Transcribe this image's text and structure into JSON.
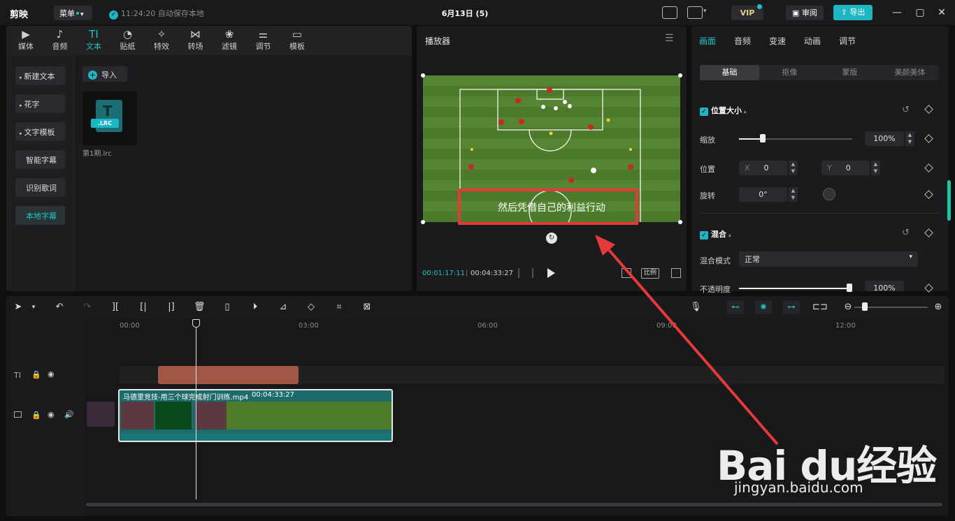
{
  "app": {
    "logo": "剪映",
    "menu": "菜单",
    "autosave": "11:24:20 自动保存本地",
    "title": "6月13日 (5)",
    "vip": "VIP",
    "review": "审阅",
    "export": "导出"
  },
  "left": {
    "tabs": [
      {
        "label": "媒体",
        "icon": "media-icon"
      },
      {
        "label": "音频",
        "icon": "audio-icon"
      },
      {
        "label": "文本",
        "icon": "text-icon",
        "active": true
      },
      {
        "label": "贴纸",
        "icon": "sticker-icon"
      },
      {
        "label": "特效",
        "icon": "effect-icon"
      },
      {
        "label": "转场",
        "icon": "transition-icon"
      },
      {
        "label": "滤镜",
        "icon": "filter-icon"
      },
      {
        "label": "调节",
        "icon": "adjust-icon"
      },
      {
        "label": "模板",
        "icon": "template-icon"
      }
    ],
    "side": [
      "新建文本",
      "花字",
      "文字模板",
      "智能字幕",
      "识别歌词",
      "本地字幕"
    ],
    "import": "导入",
    "file": {
      "name": "第1期.lrc",
      "tag": ".LRC"
    }
  },
  "player": {
    "title": "播放器",
    "subtitle": "然后凭借自己的利益行动",
    "current": "00:01:17:11",
    "duration": "00:04:33:27",
    "ratio": "比例"
  },
  "right": {
    "tabs": [
      "画面",
      "音频",
      "变速",
      "动画",
      "调节"
    ],
    "seg": [
      "基础",
      "抠像",
      "蒙版",
      "美颜美体"
    ],
    "pos_size": "位置大小",
    "scale_label": "缩放",
    "scale": "100%",
    "scale_level": 1.0,
    "position_label": "位置",
    "x_label": "X",
    "x": "0",
    "y_label": "Y",
    "y": "0",
    "rotate_label": "旋转",
    "rotate": "0°",
    "blend": "混合",
    "blend_mode_label": "混合模式",
    "blend_mode": "正常",
    "opacity_label": "不透明度",
    "opacity": "100%"
  },
  "timeline": {
    "ruler": [
      "00:00",
      "03:00",
      "06:00",
      "09:00",
      "12:00"
    ],
    "clip_name": "马德里竞技-用三个球完成射门训练.mp4",
    "clip_duration": "00:04:33:27"
  },
  "watermark": {
    "text": "Bai du经验",
    "url": "jingyan.baidu.com"
  },
  "colors": {
    "accent": "#1fc4c4",
    "annotation": "#e53a3a"
  }
}
